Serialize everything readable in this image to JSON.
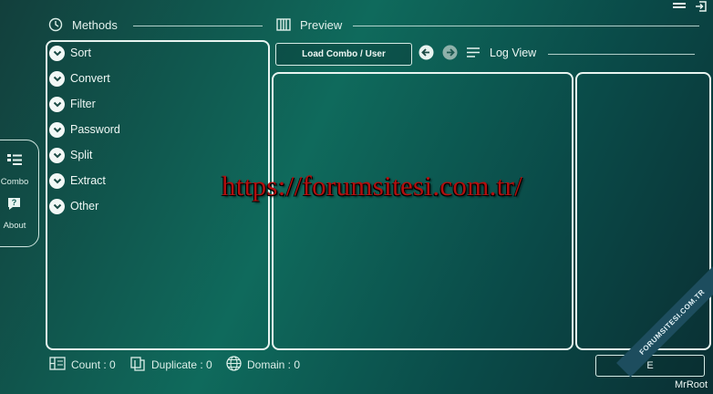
{
  "header": {
    "methods_label": "Methods",
    "preview_label": "Preview"
  },
  "methods": [
    {
      "label": "Sort"
    },
    {
      "label": "Convert"
    },
    {
      "label": "Filter"
    },
    {
      "label": "Password"
    },
    {
      "label": "Split"
    },
    {
      "label": "Extract"
    },
    {
      "label": "Other"
    }
  ],
  "sidebar": {
    "combo_label": "Combo",
    "about_label": "About"
  },
  "toolbar": {
    "load_label": "Load Combo / User",
    "log_view_label": "Log View"
  },
  "stats": {
    "count": "Count : 0",
    "duplicate": "Duplicate : 0",
    "domain": "Domain : 0"
  },
  "bottom_right": {
    "button_label": "E",
    "author": "MrRoot"
  },
  "watermark": {
    "url": "https://forumsitesi.com.tr/",
    "ribbon": "FORUMSITESI.COM.TR"
  }
}
